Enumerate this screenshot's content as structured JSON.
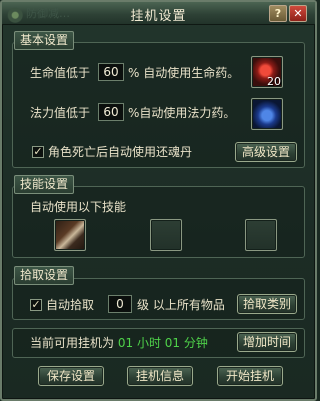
{
  "window": {
    "title": "挂机设置",
    "ghost_tab": "防御减…",
    "help_label": "?",
    "close_label": "✕"
  },
  "basic": {
    "section_label": "基本设置",
    "hp": {
      "prefix": "生命值低于",
      "value": "60",
      "suffix": "% 自动使用生命药。",
      "item_count": "20",
      "item_icon": "red-potion-icon"
    },
    "mp": {
      "prefix": "法力值低于",
      "value": "60",
      "suffix": "%自动使用法力药。",
      "item_icon": "blue-potion-icon"
    },
    "revive": {
      "label": "角色死亡后自动使用还魂丹",
      "checked": true
    },
    "advanced_button": "高级设置"
  },
  "skills": {
    "section_label": "技能设置",
    "auto_use_label": "自动使用以下技能",
    "slots": [
      {
        "icon": "sword-skill-icon",
        "filled": true
      },
      {
        "icon": "empty-slot",
        "filled": false
      },
      {
        "icon": "empty-slot",
        "filled": false
      }
    ]
  },
  "pickup": {
    "section_label": "拾取设置",
    "auto_pickup": {
      "label": "自动拾取",
      "checked": true
    },
    "level_value": "0",
    "level_suffix": "级 以上所有物品",
    "category_button": "拾取类别"
  },
  "time": {
    "prefix": "当前可用挂机为",
    "hours": "01",
    "hour_unit": "小时",
    "minutes": "01",
    "minute_unit": "分钟",
    "add_button": "增加时间"
  },
  "footer": {
    "save_button": "保存设置",
    "info_button": "挂机信息",
    "start_button": "开始挂机"
  },
  "colors": {
    "accent_green": "#4fd24a",
    "panel_bg": "#1c2c25",
    "close_red": "#c2372b"
  }
}
